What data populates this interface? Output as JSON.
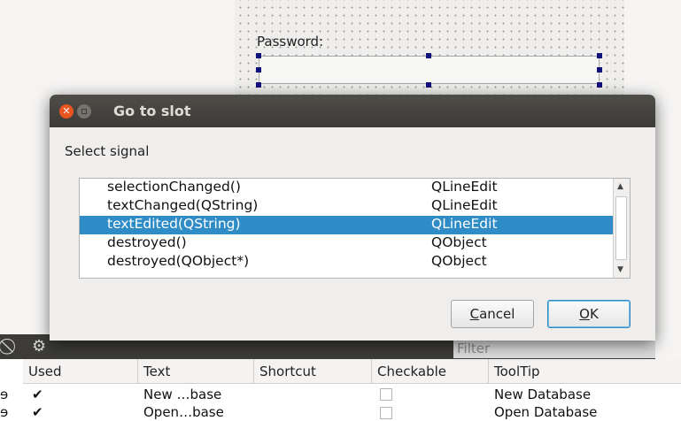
{
  "form": {
    "password_label": "Password:"
  },
  "dialog": {
    "title": "Go to slot",
    "section_label": "Select signal",
    "signals": [
      {
        "name": "selectionChanged()",
        "cls": "QLineEdit",
        "selected": false
      },
      {
        "name": "textChanged(QString)",
        "cls": "QLineEdit",
        "selected": false
      },
      {
        "name": "textEdited(QString)",
        "cls": "QLineEdit",
        "selected": true
      },
      {
        "name": "destroyed()",
        "cls": "QObject",
        "selected": false
      },
      {
        "name": "destroyed(QObject*)",
        "cls": "QObject",
        "selected": false
      }
    ],
    "cancel_mnemonic": "C",
    "cancel_rest": "ancel",
    "ok_mnemonic": "O",
    "ok_rest": "K"
  },
  "action_editor": {
    "filter_placeholder": "Filter",
    "columns": [
      "Used",
      "Text",
      "Shortcut",
      "Checkable",
      "ToolTip"
    ],
    "rows": [
      {
        "used": "✔",
        "text": "New …base",
        "tooltip": "New Database"
      },
      {
        "used": "✔",
        "text": "Open…base",
        "tooltip": "Open Database"
      }
    ]
  },
  "colors": {
    "selection": "#308cc6",
    "close_button": "#e95420",
    "titlebar": "#3c3b37"
  },
  "icons": [
    "close-icon",
    "minimize-icon",
    "no-entry-icon",
    "gear-icon",
    "scroll-up-icon",
    "scroll-down-icon"
  ]
}
